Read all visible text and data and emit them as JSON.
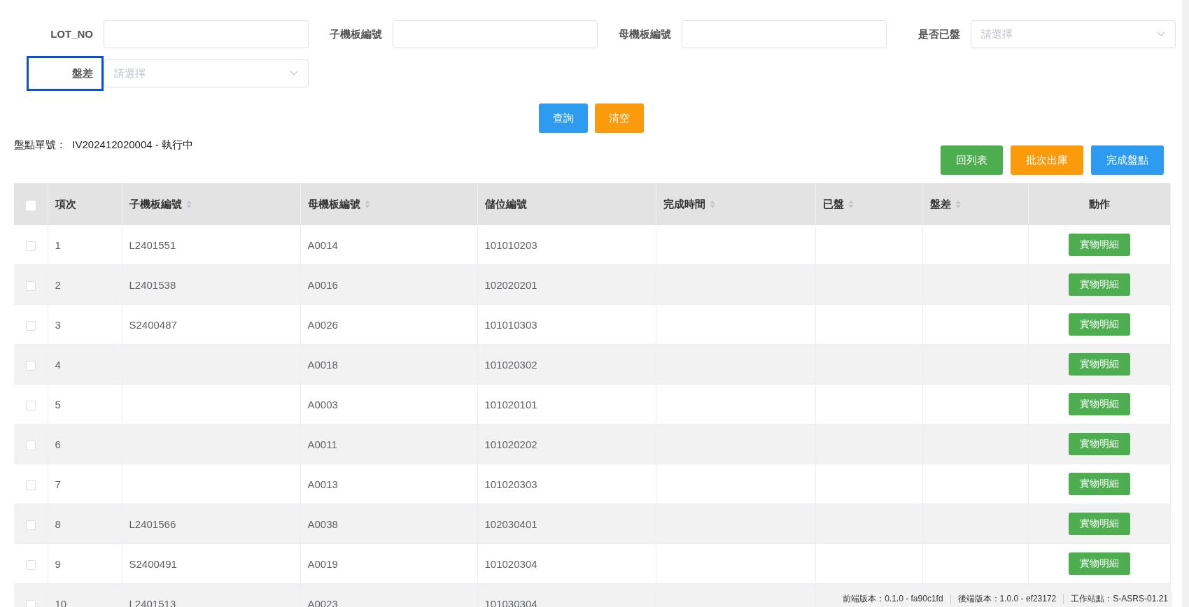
{
  "filters": [
    {
      "label": "LOT_NO",
      "kind": "input",
      "focused": false
    },
    {
      "label": "子機板編號",
      "kind": "input",
      "focused": false
    },
    {
      "label": "母機板編號",
      "kind": "input",
      "focused": false
    },
    {
      "label": "是否已盤",
      "kind": "select",
      "placeholder": "請選擇",
      "focused": false
    },
    {
      "label": "盤差",
      "kind": "select",
      "placeholder": "請選擇",
      "focused": true
    }
  ],
  "search_buttons": [
    {
      "label": "查詢",
      "kind": "primary"
    },
    {
      "label": "清空",
      "kind": "warning"
    }
  ],
  "order": {
    "label": "盤點單號：",
    "value": "IV202412020004 - 執行中"
  },
  "action_buttons": [
    {
      "label": "回列表",
      "kind": "success"
    },
    {
      "label": "批次出庫",
      "kind": "warning"
    },
    {
      "label": "完成盤點",
      "kind": "primary"
    }
  ],
  "table": {
    "all_checked": false,
    "columns": [
      {
        "label": "項次",
        "sortable": false
      },
      {
        "label": "子機板編號",
        "sortable": true
      },
      {
        "label": "母機板編號",
        "sortable": true
      },
      {
        "label": "儲位編號",
        "sortable": false
      },
      {
        "label": "完成時間",
        "sortable": true
      },
      {
        "label": "已盤",
        "sortable": true
      },
      {
        "label": "盤差",
        "sortable": true
      },
      {
        "label": "動作",
        "sortable": false
      }
    ],
    "rows": [
      {
        "checked": false,
        "cells": [
          "1",
          "L2401551",
          "A0014",
          "101010203",
          "",
          "",
          ""
        ],
        "action": "實物明細"
      },
      {
        "checked": false,
        "cells": [
          "2",
          "L2401538",
          "A0016",
          "102020201",
          "",
          "",
          ""
        ],
        "action": "實物明細"
      },
      {
        "checked": false,
        "cells": [
          "3",
          "S2400487",
          "A0026",
          "101010303",
          "",
          "",
          ""
        ],
        "action": "實物明細"
      },
      {
        "checked": false,
        "cells": [
          "4",
          "",
          "A0018",
          "101020302",
          "",
          "",
          ""
        ],
        "action": "實物明細"
      },
      {
        "checked": false,
        "cells": [
          "5",
          "",
          "A0003",
          "101020101",
          "",
          "",
          ""
        ],
        "action": "實物明細"
      },
      {
        "checked": false,
        "cells": [
          "6",
          "",
          "A0011",
          "101020202",
          "",
          "",
          ""
        ],
        "action": "實物明細"
      },
      {
        "checked": false,
        "cells": [
          "7",
          "",
          "A0013",
          "101020303",
          "",
          "",
          ""
        ],
        "action": "實物明細"
      },
      {
        "checked": false,
        "cells": [
          "8",
          "L2401566",
          "A0038",
          "102030401",
          "",
          "",
          ""
        ],
        "action": "實物明細"
      },
      {
        "checked": false,
        "cells": [
          "9",
          "S2400491",
          "A0019",
          "101020304",
          "",
          "",
          ""
        ],
        "action": "實物明細"
      },
      {
        "checked": false,
        "cells": [
          "10",
          "L2401513",
          "A0023",
          "101030304",
          "",
          "",
          ""
        ]
      }
    ]
  },
  "footer": [
    "前端版本：0.1.0 - fa90c1fd",
    "後端版本：1.0.0 - ef23172",
    "工作站點：S-ASRS-01.21"
  ]
}
